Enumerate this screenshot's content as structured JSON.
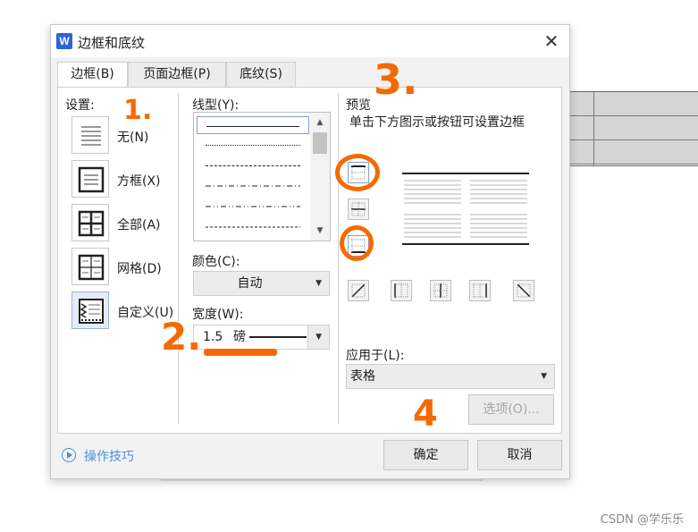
{
  "dialog": {
    "app_logo_letter": "W",
    "title": "边框和底纹",
    "close_symbol": "✕"
  },
  "tabs": [
    {
      "label": "边框(B)",
      "active": true
    },
    {
      "label": "页面边框(P)",
      "active": false
    },
    {
      "label": "底纹(S)",
      "active": false
    }
  ],
  "settings": {
    "label": "设置:",
    "items": [
      {
        "label": "无(N)",
        "icon": "no-border-icon"
      },
      {
        "label": "方框(X)",
        "icon": "box-border-icon"
      },
      {
        "label": "全部(A)",
        "icon": "all-borders-icon"
      },
      {
        "label": "网格(D)",
        "icon": "grid-border-icon"
      },
      {
        "label": "自定义(U)",
        "icon": "custom-border-icon",
        "selected": true
      }
    ]
  },
  "style": {
    "label": "线型(Y):",
    "options": [
      "solid",
      "dotted",
      "dashed",
      "dash-dot",
      "dash-dot-dot",
      "long-dash"
    ],
    "selected_index": 0
  },
  "color": {
    "label": "颜色(C):",
    "value": "自动"
  },
  "width": {
    "label": "宽度(W):",
    "value": "1.5",
    "unit": "磅"
  },
  "preview": {
    "label": "预览",
    "hint": "单击下方图示或按钮可设置边框"
  },
  "apply_to": {
    "label": "应用于(L):",
    "value": "表格"
  },
  "buttons": {
    "options": "选项(O)...",
    "ok": "确定",
    "cancel": "取消"
  },
  "tips": {
    "label": "操作技巧"
  },
  "annotations": [
    "1.",
    "2.",
    "3.",
    "4"
  ],
  "watermark": "CSDN @学乐乐",
  "colors": {
    "accent_annotation": "#f56a00",
    "link_blue": "#4d8ed8",
    "logo_blue": "#2b64d9"
  }
}
